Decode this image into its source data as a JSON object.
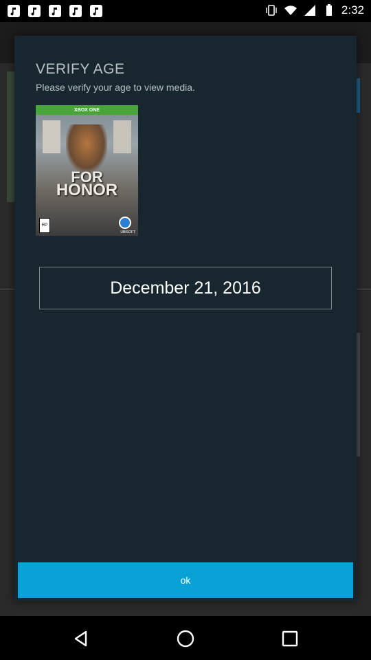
{
  "status_bar": {
    "time": "2:32",
    "left_icons": [
      "notification-icon",
      "notification-icon",
      "notification-icon",
      "notification-icon",
      "notification-icon"
    ],
    "right_icons": [
      "vibrate-icon",
      "wifi-icon",
      "signal-icon",
      "battery-icon"
    ]
  },
  "dialog": {
    "title": "VERIFY AGE",
    "subtitle": "Please verify your age to view media.",
    "cover": {
      "platform": "XBOX ONE",
      "title_line1": "FOR",
      "title_line2": "HONOR",
      "rating": "RP",
      "publisher": "UBISOFT"
    },
    "date_value": "December 21, 2016",
    "ok_label": "ok"
  },
  "nav_bar": {
    "items": [
      "back-icon",
      "home-icon",
      "recents-icon"
    ]
  }
}
